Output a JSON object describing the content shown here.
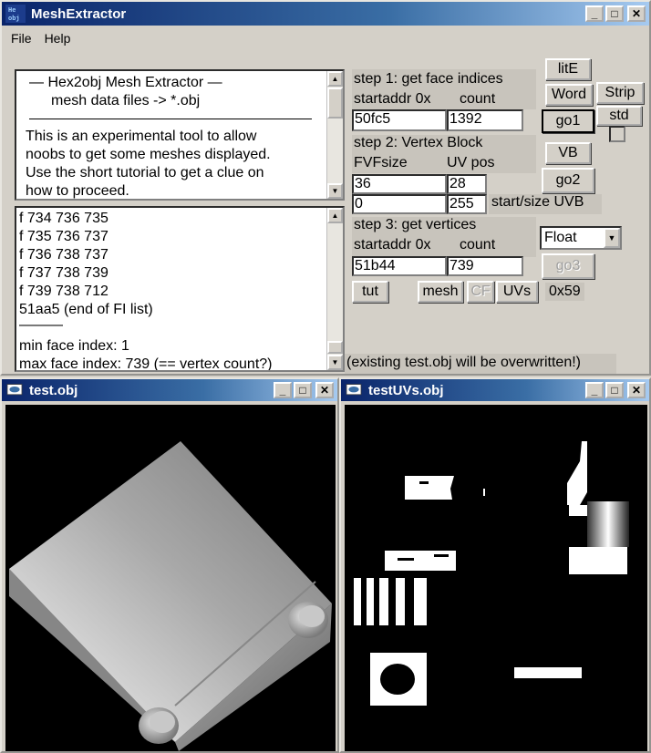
{
  "main": {
    "title": "MeshExtractor",
    "icon_text": "Hex obj",
    "menu": {
      "file": "File",
      "help": "Help"
    }
  },
  "info": {
    "line1": "—   Hex2obj Mesh Extractor   —",
    "line2": "mesh data files -> *.obj",
    "para": [
      "This is an experimental tool to allow",
      "noobs to get some meshes displayed.",
      "Use the short tutorial to get a clue on",
      "how to proceed."
    ]
  },
  "log": {
    "lines": [
      "f  734 736 735",
      "f  735 736 737",
      "f  736 738 737",
      "f  737 738 739",
      "f  739 738 712",
      "51aa5 (end of FI list)",
      "———",
      "min face index: 1",
      "max face index: 739 (== vertex count?)"
    ]
  },
  "step1": {
    "title": "step 1: get face indices",
    "addr_label": "startaddr 0x",
    "count_label": "count",
    "addr": "50fc5",
    "count": "1392"
  },
  "step2": {
    "title": "step 2: Vertex Block",
    "fvf_label": "FVFsize",
    "uv_label": "UV pos",
    "fvf": "36",
    "uv": "28",
    "uvb_start": "0",
    "uvb_size": "255",
    "uvb_label": "start/size UVB"
  },
  "step3": {
    "title": "step 3: get vertices",
    "addr_label": "startaddr 0x",
    "count_label": "count",
    "addr": "51b44",
    "count": "739",
    "type": "Float"
  },
  "buttons": {
    "lite": "litE",
    "word": "Word",
    "strip": "Strip",
    "go1": "go1",
    "std": "std",
    "vb": "VB",
    "go2": "go2",
    "go3": "go3",
    "tut": "tut",
    "mesh": "mesh",
    "cf": "CF",
    "uvs": "UVs",
    "hex": "0x59"
  },
  "warning": "(existing test.obj will be overwritten!)",
  "view1": {
    "title": "test.obj"
  },
  "view2": {
    "title": "testUVs.obj"
  },
  "colors": {
    "titlebar": "#0a246a",
    "face": "#d4d0c8"
  }
}
